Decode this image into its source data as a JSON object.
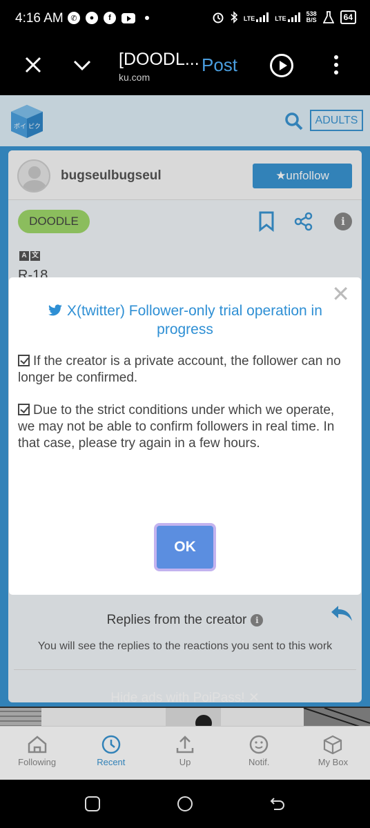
{
  "status_bar": {
    "time": "4:16 AM",
    "network_left": "LTE",
    "network_right": "LTE",
    "speed_value": "538",
    "speed_unit": "B/S",
    "battery": "64"
  },
  "browser": {
    "title": "[DOODL...",
    "url": "ku.com",
    "post_label": "Post"
  },
  "header": {
    "adults_label": "ADULTS"
  },
  "post": {
    "username": "bugseulbugseul",
    "unfollow_label": "★unfollow",
    "category": "DOODLE",
    "rating_text": "R-18",
    "replies_title": "Replies from the creator",
    "replies_desc": "You will see the replies to the reactions you sent to this work",
    "hide_ads": "Hide ads with PoiPass!"
  },
  "dialog": {
    "title": "X(twitter) Follower-only trial operation in progress",
    "para1": "If the creator is a private account, the follower can no longer be confirmed.",
    "para2": "Due to the strict conditions under which we operate, we may not be able to confirm followers in real time. In that case, please try again in a few hours.",
    "ok_label": "OK"
  },
  "tabs": [
    {
      "label": "Following",
      "icon": "home-icon"
    },
    {
      "label": "Recent",
      "icon": "clock-icon"
    },
    {
      "label": "Up",
      "icon": "upload-icon"
    },
    {
      "label": "Notif.",
      "icon": "smiley-icon"
    },
    {
      "label": "My Box",
      "icon": "box-icon"
    }
  ],
  "colors": {
    "accent": "#3a94d2",
    "ok_button": "#5b8ee0",
    "doodle_tag": "#9fd86a"
  }
}
